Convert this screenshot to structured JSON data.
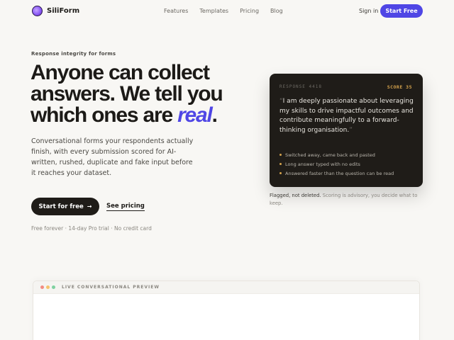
{
  "nav": {
    "brand": "SiliForm",
    "links": [
      "Features",
      "Templates",
      "Pricing",
      "Blog"
    ],
    "signin": "Sign in",
    "cta": "Start Free"
  },
  "hero": {
    "eyebrow": "Response integrity for forms",
    "headline_main": "Anyone can collect answers. We tell you which ones are ",
    "headline_accent": "real",
    "headline_end": ".",
    "subcopy": "Conversational forms your respondents actually finish, with every submission scored for AI-written, rushed, duplicate and fake input before it reaches your dataset.",
    "cta_primary": "Start for free",
    "cta_primary_icon": "arrow-right-icon",
    "cta_secondary": "See pricing",
    "fineprint": "Free forever · 14-day Pro trial · No credit card"
  },
  "card": {
    "label": "RESPONSE 4418",
    "score": "SCORE 35",
    "quote": "I am deeply passionate about leveraging my skills to drive impactful outcomes and contribute meaningfully to a forward-thinking organisation.",
    "quote_open": "“",
    "quote_close": "”",
    "flags": [
      "Switched away, came back and pasted",
      "Long answer typed with no edits",
      "Answered faster than the question can be read"
    ],
    "accent_color": "#d4a24c"
  },
  "card_note": {
    "bold": "Flagged, not deleted.",
    "rest": " Scoring is advisory, you decide what to keep."
  },
  "preview": {
    "title": "LIVE CONVERSATIONAL PREVIEW",
    "dots": [
      "#f28b82",
      "#f6c36b",
      "#7fd1a0"
    ]
  },
  "colors": {
    "brand": "#4f46e5",
    "dark": "#1f1c18",
    "background": "#f8f7f4"
  }
}
